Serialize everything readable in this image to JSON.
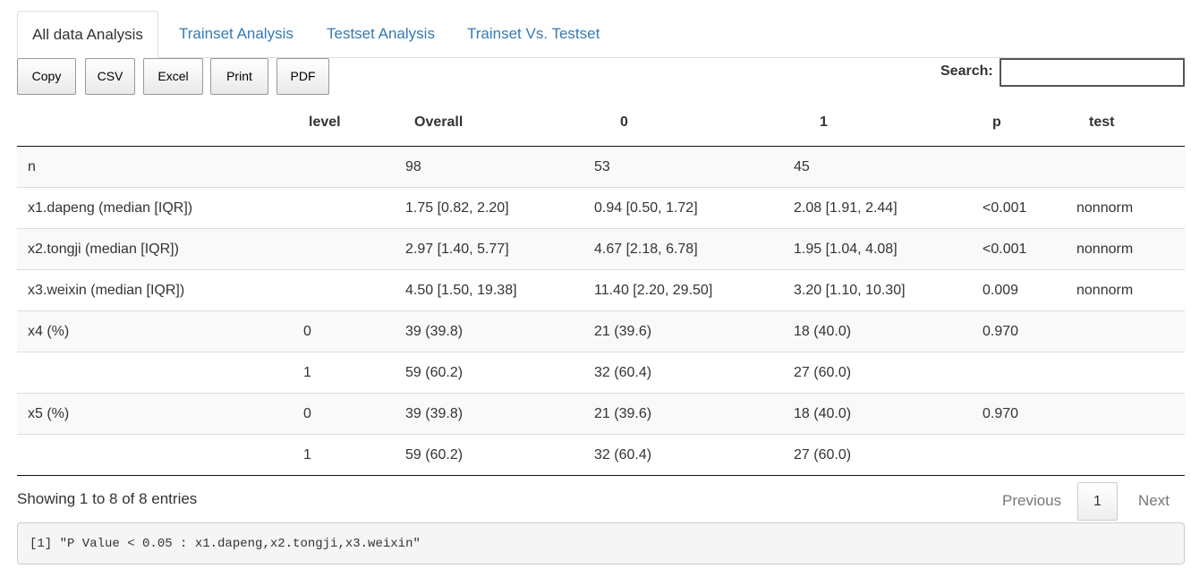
{
  "tabs": [
    {
      "label": "All data Analysis",
      "active": true
    },
    {
      "label": "Trainset Analysis",
      "active": false
    },
    {
      "label": "Testset Analysis",
      "active": false
    },
    {
      "label": "Trainset Vs. Testset",
      "active": false
    }
  ],
  "buttons": [
    "Copy",
    "CSV",
    "Excel",
    "Print",
    "PDF"
  ],
  "search": {
    "label": "Search:",
    "value": ""
  },
  "table": {
    "headers": [
      "",
      "level",
      "Overall",
      "0",
      "1",
      "p",
      "test"
    ],
    "rows": [
      [
        "n",
        "",
        "98",
        "53",
        "45",
        "",
        ""
      ],
      [
        "x1.dapeng (median [IQR])",
        "",
        "1.75 [0.82, 2.20]",
        "0.94 [0.50, 1.72]",
        "2.08 [1.91, 2.44]",
        "<0.001",
        "nonnorm"
      ],
      [
        "x2.tongji (median [IQR])",
        "",
        "2.97 [1.40, 5.77]",
        "4.67 [2.18, 6.78]",
        "1.95 [1.04, 4.08]",
        "<0.001",
        "nonnorm"
      ],
      [
        "x3.weixin (median [IQR])",
        "",
        "4.50 [1.50, 19.38]",
        "11.40 [2.20, 29.50]",
        "3.20 [1.10, 10.30]",
        "0.009",
        "nonnorm"
      ],
      [
        "x4 (%)",
        "0",
        "39 (39.8)",
        "21 (39.6)",
        "18 (40.0)",
        "0.970",
        ""
      ],
      [
        "",
        "1",
        "59 (60.2)",
        "32 (60.4)",
        "27 (60.0)",
        "",
        ""
      ],
      [
        "x5 (%)",
        "0",
        "39 (39.8)",
        "21 (39.6)",
        "18 (40.0)",
        "0.970",
        ""
      ],
      [
        "",
        "1",
        "59 (60.2)",
        "32 (60.4)",
        "27 (60.0)",
        "",
        ""
      ]
    ]
  },
  "info": "Showing 1 to 8 of 8 entries",
  "pager": {
    "prev": "Previous",
    "current": "1",
    "next": "Next"
  },
  "output": "[1] \"P Value < 0.05 : x1.dapeng,x2.tongji,x3.weixin\""
}
